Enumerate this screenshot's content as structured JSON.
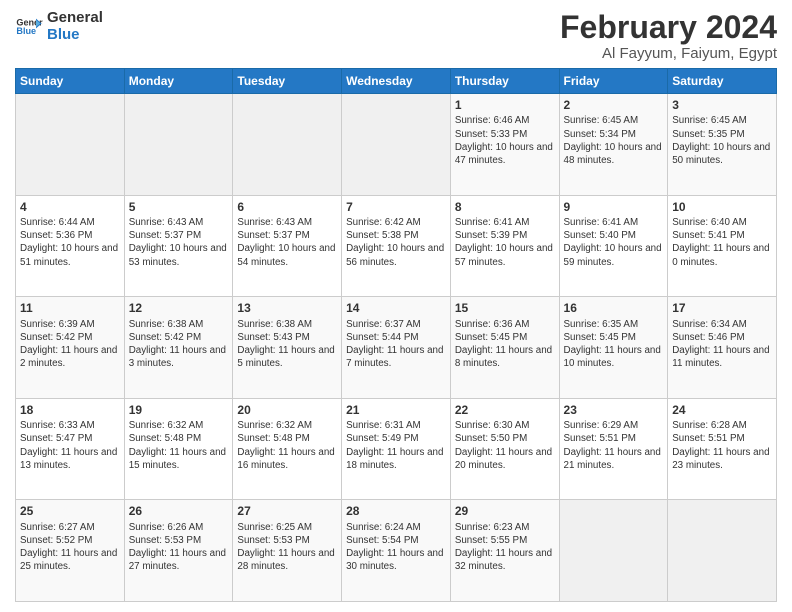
{
  "header": {
    "logo_line1": "General",
    "logo_line2": "Blue",
    "title": "February 2024",
    "subtitle": "Al Fayyum, Faiyum, Egypt"
  },
  "weekdays": [
    "Sunday",
    "Monday",
    "Tuesday",
    "Wednesday",
    "Thursday",
    "Friday",
    "Saturday"
  ],
  "weeks": [
    [
      {
        "day": "",
        "info": ""
      },
      {
        "day": "",
        "info": ""
      },
      {
        "day": "",
        "info": ""
      },
      {
        "day": "",
        "info": ""
      },
      {
        "day": "1",
        "info": "Sunrise: 6:46 AM\nSunset: 5:33 PM\nDaylight: 10 hours and 47 minutes."
      },
      {
        "day": "2",
        "info": "Sunrise: 6:45 AM\nSunset: 5:34 PM\nDaylight: 10 hours and 48 minutes."
      },
      {
        "day": "3",
        "info": "Sunrise: 6:45 AM\nSunset: 5:35 PM\nDaylight: 10 hours and 50 minutes."
      }
    ],
    [
      {
        "day": "4",
        "info": "Sunrise: 6:44 AM\nSunset: 5:36 PM\nDaylight: 10 hours and 51 minutes."
      },
      {
        "day": "5",
        "info": "Sunrise: 6:43 AM\nSunset: 5:37 PM\nDaylight: 10 hours and 53 minutes."
      },
      {
        "day": "6",
        "info": "Sunrise: 6:43 AM\nSunset: 5:37 PM\nDaylight: 10 hours and 54 minutes."
      },
      {
        "day": "7",
        "info": "Sunrise: 6:42 AM\nSunset: 5:38 PM\nDaylight: 10 hours and 56 minutes."
      },
      {
        "day": "8",
        "info": "Sunrise: 6:41 AM\nSunset: 5:39 PM\nDaylight: 10 hours and 57 minutes."
      },
      {
        "day": "9",
        "info": "Sunrise: 6:41 AM\nSunset: 5:40 PM\nDaylight: 10 hours and 59 minutes."
      },
      {
        "day": "10",
        "info": "Sunrise: 6:40 AM\nSunset: 5:41 PM\nDaylight: 11 hours and 0 minutes."
      }
    ],
    [
      {
        "day": "11",
        "info": "Sunrise: 6:39 AM\nSunset: 5:42 PM\nDaylight: 11 hours and 2 minutes."
      },
      {
        "day": "12",
        "info": "Sunrise: 6:38 AM\nSunset: 5:42 PM\nDaylight: 11 hours and 3 minutes."
      },
      {
        "day": "13",
        "info": "Sunrise: 6:38 AM\nSunset: 5:43 PM\nDaylight: 11 hours and 5 minutes."
      },
      {
        "day": "14",
        "info": "Sunrise: 6:37 AM\nSunset: 5:44 PM\nDaylight: 11 hours and 7 minutes."
      },
      {
        "day": "15",
        "info": "Sunrise: 6:36 AM\nSunset: 5:45 PM\nDaylight: 11 hours and 8 minutes."
      },
      {
        "day": "16",
        "info": "Sunrise: 6:35 AM\nSunset: 5:45 PM\nDaylight: 11 hours and 10 minutes."
      },
      {
        "day": "17",
        "info": "Sunrise: 6:34 AM\nSunset: 5:46 PM\nDaylight: 11 hours and 11 minutes."
      }
    ],
    [
      {
        "day": "18",
        "info": "Sunrise: 6:33 AM\nSunset: 5:47 PM\nDaylight: 11 hours and 13 minutes."
      },
      {
        "day": "19",
        "info": "Sunrise: 6:32 AM\nSunset: 5:48 PM\nDaylight: 11 hours and 15 minutes."
      },
      {
        "day": "20",
        "info": "Sunrise: 6:32 AM\nSunset: 5:48 PM\nDaylight: 11 hours and 16 minutes."
      },
      {
        "day": "21",
        "info": "Sunrise: 6:31 AM\nSunset: 5:49 PM\nDaylight: 11 hours and 18 minutes."
      },
      {
        "day": "22",
        "info": "Sunrise: 6:30 AM\nSunset: 5:50 PM\nDaylight: 11 hours and 20 minutes."
      },
      {
        "day": "23",
        "info": "Sunrise: 6:29 AM\nSunset: 5:51 PM\nDaylight: 11 hours and 21 minutes."
      },
      {
        "day": "24",
        "info": "Sunrise: 6:28 AM\nSunset: 5:51 PM\nDaylight: 11 hours and 23 minutes."
      }
    ],
    [
      {
        "day": "25",
        "info": "Sunrise: 6:27 AM\nSunset: 5:52 PM\nDaylight: 11 hours and 25 minutes."
      },
      {
        "day": "26",
        "info": "Sunrise: 6:26 AM\nSunset: 5:53 PM\nDaylight: 11 hours and 27 minutes."
      },
      {
        "day": "27",
        "info": "Sunrise: 6:25 AM\nSunset: 5:53 PM\nDaylight: 11 hours and 28 minutes."
      },
      {
        "day": "28",
        "info": "Sunrise: 6:24 AM\nSunset: 5:54 PM\nDaylight: 11 hours and 30 minutes."
      },
      {
        "day": "29",
        "info": "Sunrise: 6:23 AM\nSunset: 5:55 PM\nDaylight: 11 hours and 32 minutes."
      },
      {
        "day": "",
        "info": ""
      },
      {
        "day": "",
        "info": ""
      }
    ]
  ]
}
